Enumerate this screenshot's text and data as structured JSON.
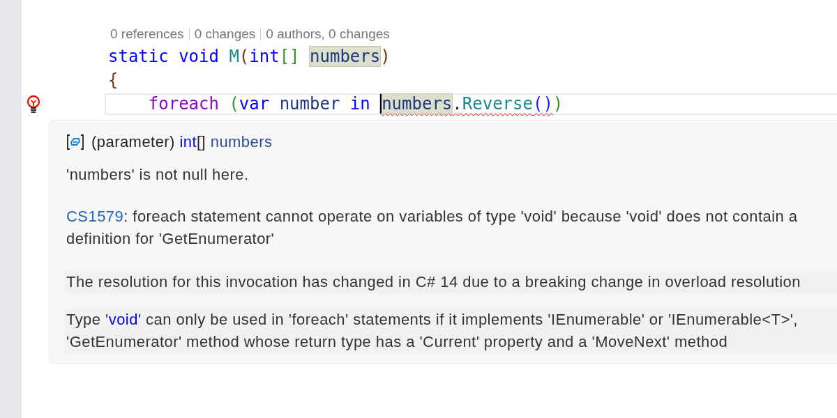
{
  "codelens": [
    "0 references",
    "0 changes",
    "0 authors, 0 changes"
  ],
  "code_lines": [
    {
      "current": false,
      "lightbulb": false,
      "tokens": [
        {
          "text": "static void",
          "kind": "keyword"
        },
        {
          "text": " M",
          "kind": "method"
        },
        {
          "text": "(",
          "kind": "bracket1"
        },
        {
          "text": "int",
          "kind": "keyword"
        },
        {
          "text": "[] ",
          "kind": "bracket2"
        },
        {
          "text": "numbers",
          "kind": "ident",
          "highlight": true
        },
        {
          "text": ")",
          "kind": "bracket1"
        }
      ]
    },
    {
      "current": false,
      "lightbulb": false,
      "tokens": [
        {
          "text": "{",
          "kind": "bracket1"
        }
      ]
    },
    {
      "current": true,
      "lightbulb": true,
      "tokens": [
        {
          "text": "    foreach",
          "kind": "control"
        },
        {
          "text": " (",
          "kind": "bracket2"
        },
        {
          "text": "var",
          "kind": "keyword"
        },
        {
          "text": " number",
          "kind": "ident"
        },
        {
          "text": " in ",
          "kind": "keyword"
        },
        {
          "text": "numbers",
          "kind": "ident",
          "highlight": true,
          "caret": true,
          "error": true
        },
        {
          "text": ".",
          "kind": "punct",
          "error": true
        },
        {
          "text": "Reverse",
          "kind": "method",
          "error": true
        },
        {
          "text": "()",
          "kind": "bracket3",
          "error": true
        },
        {
          "text": ")",
          "kind": "bracket2"
        }
      ]
    }
  ],
  "tooltip": {
    "signature": [
      {
        "text": "(parameter) ",
        "kind": "plain"
      },
      {
        "text": "int",
        "kind": "keyword"
      },
      {
        "text": "[] ",
        "kind": "plain"
      },
      {
        "text": "numbers",
        "kind": "param"
      }
    ],
    "nullability": "'numbers' is not null here.",
    "error": {
      "code": "CS1579",
      "lines": [
        ": foreach statement cannot operate on variables of type 'void' because 'void' does not contain a",
        "definition for 'GetEnumerator'"
      ]
    },
    "notes": [
      {
        "lines": [
          [
            {
              "text": "The resolution for this invocation has changed in C# 14 due to a breaking change in overload resolution",
              "kind": "plain"
            }
          ]
        ]
      },
      {
        "lines": [
          [
            {
              "text": "Type '",
              "kind": "plain"
            },
            {
              "text": "void",
              "kind": "keyword"
            },
            {
              "text": "' can only be used in 'foreach' statements if it implements 'IEnumerable' or 'IEnumerable<T>',",
              "kind": "plain"
            }
          ],
          [
            {
              "text": "'GetEnumerator' method whose return type has a 'Current' property and a 'MoveNext' method",
              "kind": "plain"
            }
          ]
        ]
      }
    ]
  }
}
